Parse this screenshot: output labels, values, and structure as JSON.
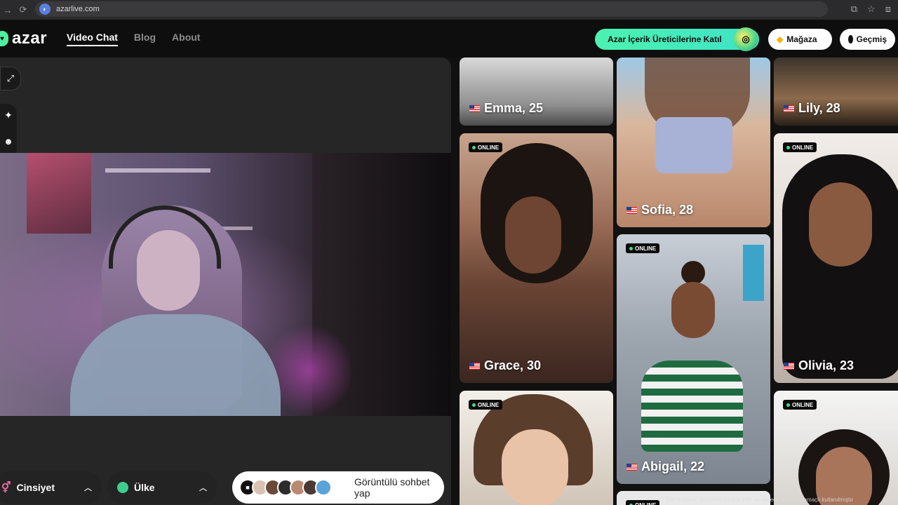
{
  "browser": {
    "url": "azarlive.com"
  },
  "header": {
    "logo": "azar",
    "nav": [
      {
        "label": "Video Chat",
        "active": true
      },
      {
        "label": "Blog",
        "active": false
      },
      {
        "label": "About",
        "active": false
      }
    ],
    "creator_cta": "Azar İçerik Üreticilerine Katıl",
    "store": "Mağaza",
    "history": "Geçmiş"
  },
  "filters": {
    "gender": "Cinsiyet",
    "country": "Ülke",
    "start": "Görüntülü sohbet yap"
  },
  "online_label": "ONLINE",
  "profiles": [
    {
      "name": "Emma, 25",
      "country": "US",
      "online": false
    },
    {
      "name": "Grace, 30",
      "country": "US",
      "online": true
    },
    {
      "name": "",
      "country": "",
      "online": true
    },
    {
      "name": "Sofia, 28",
      "country": "US",
      "online": false
    },
    {
      "name": "Abigail, 22",
      "country": "US",
      "online": true
    },
    {
      "name": "Lily, 28",
      "country": "US",
      "online": false
    },
    {
      "name": "Olivia, 23",
      "country": "US",
      "online": true
    },
    {
      "name": "",
      "country": "",
      "online": true
    }
  ],
  "disclaimer": "Tüm kullanıcı görselleri Azar'a aittir ve sadece gösterim amaçlı kullanılmıştır",
  "colors": {
    "accent": "#3ee8b0",
    "background": "#111111",
    "panel": "#262626"
  }
}
